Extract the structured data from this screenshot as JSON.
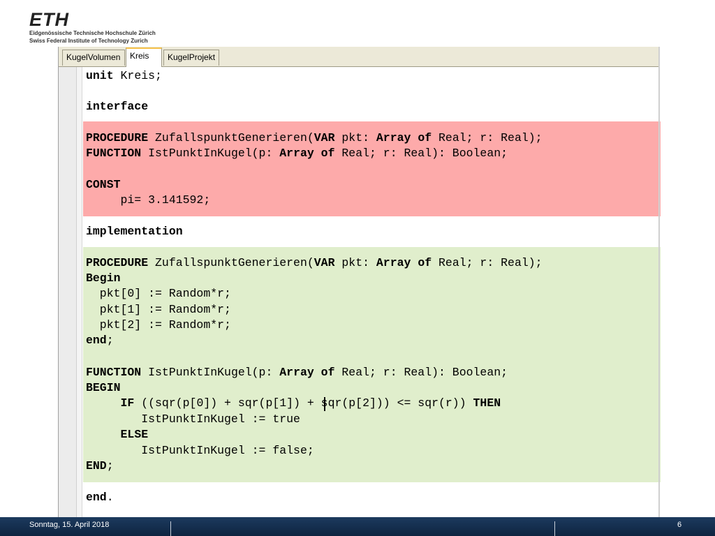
{
  "logo": {
    "wordmark": "ETH",
    "line1": "Eidgenössische Technische Hochschule Zürich",
    "line2": "Swiss Federal Institute of Technology Zurich"
  },
  "tabs": [
    {
      "label": "KugelVolumen",
      "active": false
    },
    {
      "label": "Kreis",
      "active": true
    },
    {
      "label": "KugelProjekt",
      "active": false
    }
  ],
  "code": {
    "l01": {
      "kw": "unit",
      "rest": " Kreis;"
    },
    "l02": {
      "kw": "interface",
      "rest": ""
    },
    "l03": {
      "kw": "PROCEDURE",
      "a": " ZufallspunktGenerieren(",
      "kw2": "VAR",
      "b": " pkt: ",
      "kw3": "Array of",
      "c": " Real; r: Real);"
    },
    "l04": {
      "kw": "FUNCTION",
      "a": " IstPunktInKugel(p: ",
      "kw2": "Array of",
      "b": " Real; r: Real): Boolean;"
    },
    "l05": {
      "kw": "CONST",
      "rest": ""
    },
    "l06": {
      "rest": "     pi= 3.141592;"
    },
    "l07": {
      "kw": "implementation",
      "rest": ""
    },
    "l08": {
      "kw": "PROCEDURE",
      "a": " ZufallspunktGenerieren(",
      "kw2": "VAR",
      "b": " pkt: ",
      "kw3": "Array of",
      "c": " Real; r: Real);"
    },
    "l09": {
      "kw": "Begin",
      "rest": ""
    },
    "l10": {
      "rest": "  pkt[0] := Random*r;"
    },
    "l11": {
      "rest": "  pkt[1] := Random*r;"
    },
    "l12": {
      "rest": "  pkt[2] := Random*r;"
    },
    "l13": {
      "kw": "end",
      "rest": ";"
    },
    "l14": {
      "kw": "FUNCTION",
      "a": " IstPunktInKugel(p: ",
      "kw2": "Array of",
      "b": " Real; r: Real): Boolean;"
    },
    "l15": {
      "kw": "BEGIN",
      "rest": ""
    },
    "l16": {
      "pre": "     ",
      "kw": "IF",
      "a": " ((sqr(p[0]) + sqr(p[1]) + sqr(p[2])) <= sqr(r)) ",
      "kw2": "THEN"
    },
    "l17": {
      "rest": "        IstPunktInKugel := true"
    },
    "l18": {
      "pre": "     ",
      "kw": "ELSE",
      "rest": ""
    },
    "l19": {
      "rest": "        IstPunktInKugel := false;"
    },
    "l20": {
      "kw": "END",
      "rest": ";"
    },
    "l21": {
      "kw": "end",
      "rest": "."
    }
  },
  "footer": {
    "date": "Sonntag, 15. April 2018",
    "page": "6"
  },
  "colors": {
    "interface_highlight": "#fdaaaa",
    "implementation_highlight": "#e0eecc",
    "footer_bg": "#1c3a5e"
  }
}
